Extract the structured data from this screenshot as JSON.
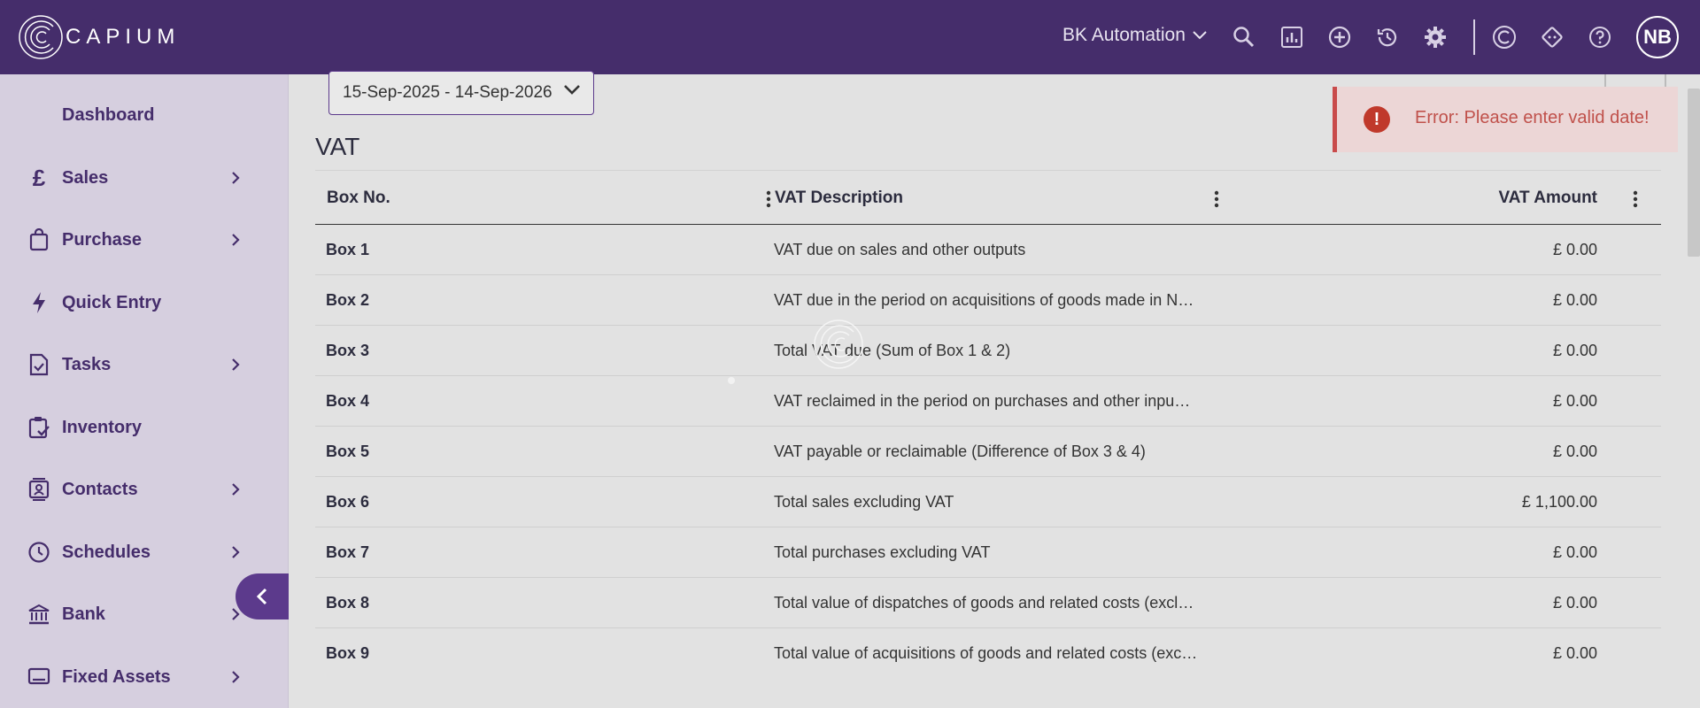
{
  "app": {
    "logo_text": "CAPIUM",
    "company": "BK Automation",
    "user_initials": "NB"
  },
  "topbar_icons": [
    "search-icon",
    "reports-icon",
    "add-circle-icon",
    "history-icon",
    "gear-icon",
    "capium-c-icon",
    "puzzle-icon",
    "help-icon"
  ],
  "sidebar": {
    "items": [
      {
        "label": "Dashboard",
        "icon": "dashboard-icon",
        "chevron": false
      },
      {
        "label": "Sales",
        "icon": "pound-icon",
        "chevron": true
      },
      {
        "label": "Purchase",
        "icon": "shopping-bag-icon",
        "chevron": true
      },
      {
        "label": "Quick Entry",
        "icon": "bolt-icon",
        "chevron": false
      },
      {
        "label": "Tasks",
        "icon": "task-check-icon",
        "chevron": true
      },
      {
        "label": "Inventory",
        "icon": "inventory-icon",
        "chevron": false
      },
      {
        "label": "Contacts",
        "icon": "contacts-icon",
        "chevron": true
      },
      {
        "label": "Schedules",
        "icon": "clock-icon",
        "chevron": true
      },
      {
        "label": "Bank",
        "icon": "bank-icon",
        "chevron": true
      },
      {
        "label": "Fixed Assets",
        "icon": "laptop-icon",
        "chevron": true
      }
    ]
  },
  "main": {
    "date_range": "15-Sep-2025 - 14-Sep-2026",
    "title": "VAT",
    "columns": [
      "Box No.",
      "VAT Description",
      "VAT Amount"
    ],
    "rows": [
      {
        "box": "Box 1",
        "desc": "VAT due on sales and other outputs",
        "amount": "£ 0.00"
      },
      {
        "box": "Box 2",
        "desc": "VAT due in the period on acquisitions of goods made in N…",
        "amount": "£ 0.00"
      },
      {
        "box": "Box 3",
        "desc": "Total VAT due (Sum of Box 1 & 2)",
        "amount": "£ 0.00"
      },
      {
        "box": "Box 4",
        "desc": "VAT reclaimed in the period on purchases and other inpu…",
        "amount": "£ 0.00"
      },
      {
        "box": "Box 5",
        "desc": "VAT payable or reclaimable (Difference of Box 3 & 4)",
        "amount": "£ 0.00"
      },
      {
        "box": "Box 6",
        "desc": "Total sales excluding VAT",
        "amount": "£ 1,100.00"
      },
      {
        "box": "Box 7",
        "desc": "Total purchases excluding VAT",
        "amount": "£ 0.00"
      },
      {
        "box": "Box 8",
        "desc": "Total value of dispatches of goods and related costs (excl…",
        "amount": "£ 0.00"
      },
      {
        "box": "Box 9",
        "desc": "Total value of acquisitions of goods and related costs (exc…",
        "amount": "£ 0.00"
      }
    ]
  },
  "toast": {
    "message": "Error: Please enter valid date!",
    "icon": "error-icon"
  },
  "colors": {
    "brand": "#452d6b",
    "accent": "#5c3a8c",
    "error": "#c0392b"
  }
}
